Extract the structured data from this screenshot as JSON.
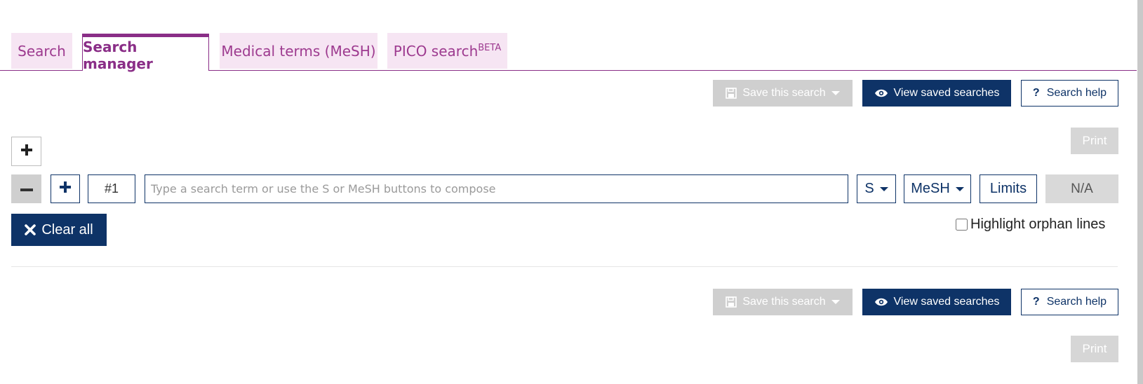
{
  "tabs": [
    {
      "label": "Search"
    },
    {
      "label": "Search manager"
    },
    {
      "label": "Medical terms (MeSH)"
    },
    {
      "label": "PICO search",
      "sup": "BETA"
    }
  ],
  "toolbar": {
    "save_label": "Save this search",
    "view_label": "View saved searches",
    "help_label": "Search help",
    "print_label": "Print"
  },
  "search_line": {
    "line_number": "#1",
    "placeholder": "Type a search term or use the S or MeSH buttons to compose",
    "value": "",
    "s_label": "S",
    "mesh_label": "MeSH",
    "limits_label": "Limits",
    "result_count": "N/A"
  },
  "actions": {
    "clear_all_label": "Clear all",
    "highlight_orphan_label": "Highlight orphan lines"
  },
  "colors": {
    "accent_purple": "#8a2e87",
    "tab_bg": "#f6e5f3",
    "navy": "#0e3367",
    "disabled_gray": "#cfcfcf"
  }
}
